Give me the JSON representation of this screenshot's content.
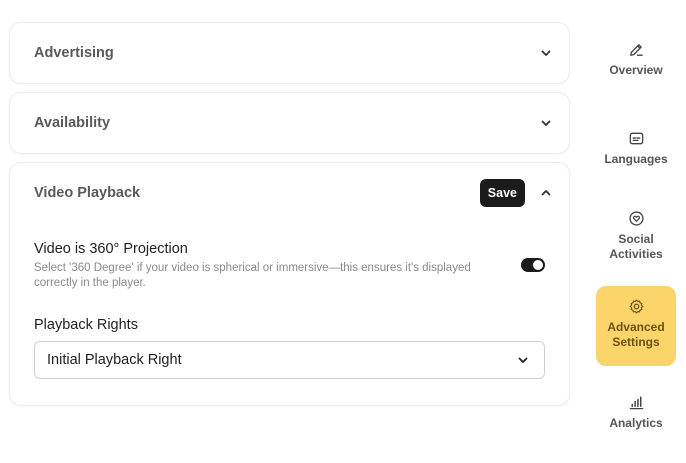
{
  "sections": {
    "advertising": {
      "title": "Advertising"
    },
    "availability": {
      "title": "Availability"
    },
    "video_playback": {
      "title": "Video Playback",
      "save_label": "Save",
      "projection_title": "Video is 360° Projection",
      "projection_desc": "Select '360 Degree' if your video is spherical or immersive—this ensures it's displayed correctly in the player.",
      "projection_enabled": true,
      "rights_label": "Playback Rights",
      "rights_value": "Initial Playback Right"
    }
  },
  "sidebar": {
    "items": [
      {
        "label": "Overview",
        "icon": "edit-icon",
        "active": false
      },
      {
        "label": "Languages",
        "icon": "subtitles-icon",
        "active": false
      },
      {
        "label": "Social\nActivities",
        "icon": "heart-badge-icon",
        "active": false
      },
      {
        "label": "Advanced\nSettings",
        "icon": "gear-icon",
        "active": true
      },
      {
        "label": "Analytics",
        "icon": "bar-chart-icon",
        "active": false
      }
    ]
  },
  "colors": {
    "accent": "#fcd56a",
    "dark": "#1b1b1b"
  }
}
